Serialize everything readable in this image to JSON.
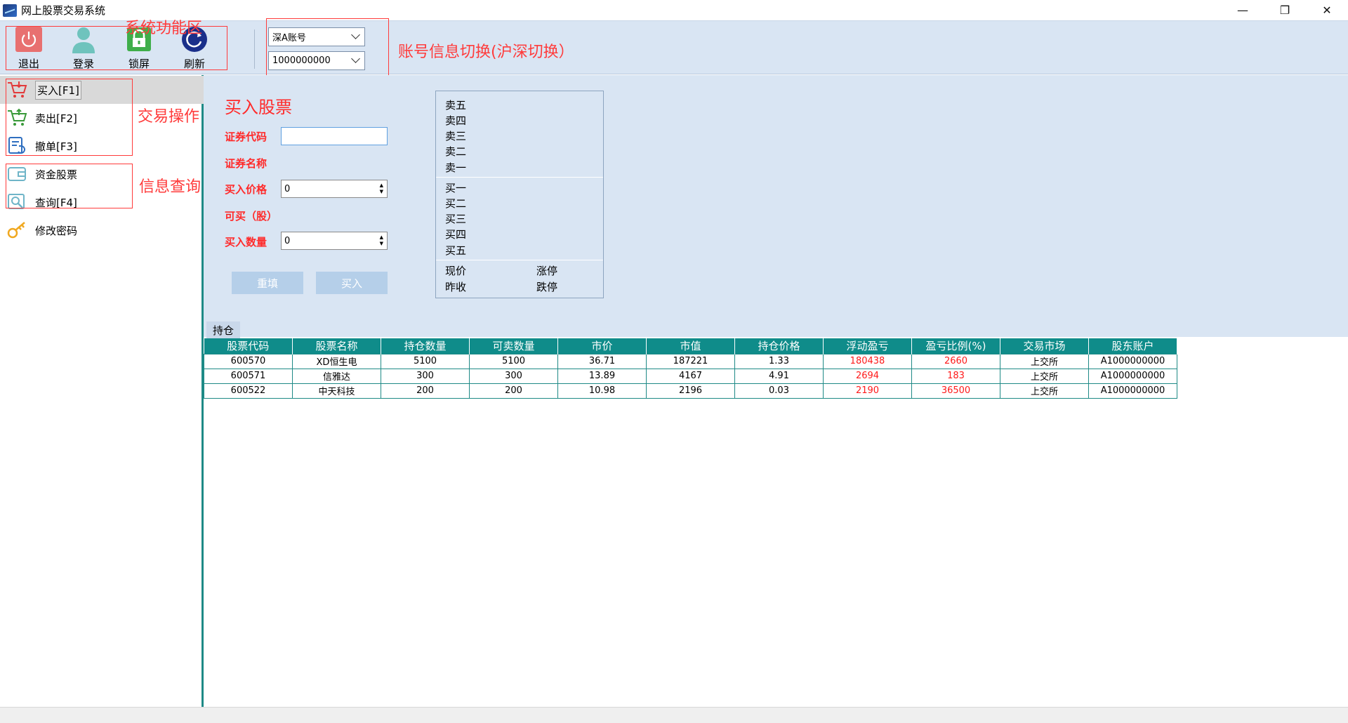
{
  "window": {
    "title": "网上股票交易系统",
    "controls": [
      "—",
      "❐",
      "✕"
    ]
  },
  "toolbar": {
    "exit_label": "退出",
    "login_label": "登录",
    "lock_label": "锁屏",
    "refresh_label": "刷新",
    "account_type": "深A账号",
    "account_number": "1000000000"
  },
  "annotations": {
    "system_area": "系统功能区",
    "account_switch": "账号信息切换(沪深切换）",
    "trade_ops": "交易操作",
    "info_query": "信息查询"
  },
  "sidebar": {
    "items": [
      {
        "label": "买入[F1]",
        "icon": "buy-cart-icon"
      },
      {
        "label": "卖出[F2]",
        "icon": "sell-cart-icon"
      },
      {
        "label": "撤单[F3]",
        "icon": "cancel-order-icon"
      },
      {
        "label": "资金股票",
        "icon": "funds-wallet-icon"
      },
      {
        "label": "查询[F4]",
        "icon": "query-search-icon"
      },
      {
        "label": "修改密码",
        "icon": "key-icon"
      }
    ]
  },
  "buy_form": {
    "title": "买入股票",
    "code_label": "证券代码",
    "code_value": "",
    "name_label": "证券名称",
    "price_label": "买入价格",
    "price_value": "0",
    "available_label": "可买（股）",
    "qty_label": "买入数量",
    "qty_value": "0",
    "reset_label": "重填",
    "buy_label": "买入"
  },
  "quote": {
    "sell_levels": [
      "卖五",
      "卖四",
      "卖三",
      "卖二",
      "卖一"
    ],
    "buy_levels": [
      "买一",
      "买二",
      "买三",
      "买四",
      "买五"
    ],
    "current_price_label": "现价",
    "limit_up_label": "涨停",
    "prev_close_label": "昨收",
    "limit_down_label": "跌停"
  },
  "holdings": {
    "tab_label": "持仓",
    "columns": [
      "股票代码",
      "股票名称",
      "持仓数量",
      "可卖数量",
      "市价",
      "市值",
      "持仓价格",
      "浮动盈亏",
      "盈亏比例(%)",
      "交易市场",
      "股东账户"
    ],
    "rows": [
      [
        "600570",
        "XD恒生电",
        "5100",
        "5100",
        "36.71",
        "187221",
        "1.33",
        "180438",
        "2660",
        "上交所",
        "A1000000000"
      ],
      [
        "600571",
        "信雅达",
        "300",
        "300",
        "13.89",
        "4167",
        "4.91",
        "2694",
        "183",
        "上交所",
        "A1000000000"
      ],
      [
        "600522",
        "中天科技",
        "200",
        "200",
        "10.98",
        "2196",
        "0.03",
        "2190",
        "36500",
        "上交所",
        "A1000000000"
      ]
    ]
  },
  "colors": {
    "accent_teal": "#0f8c8a",
    "panel_bg": "#d9e5f3",
    "annotation_red": "#ff3b3b",
    "profit_red": "#ff1a1a"
  }
}
